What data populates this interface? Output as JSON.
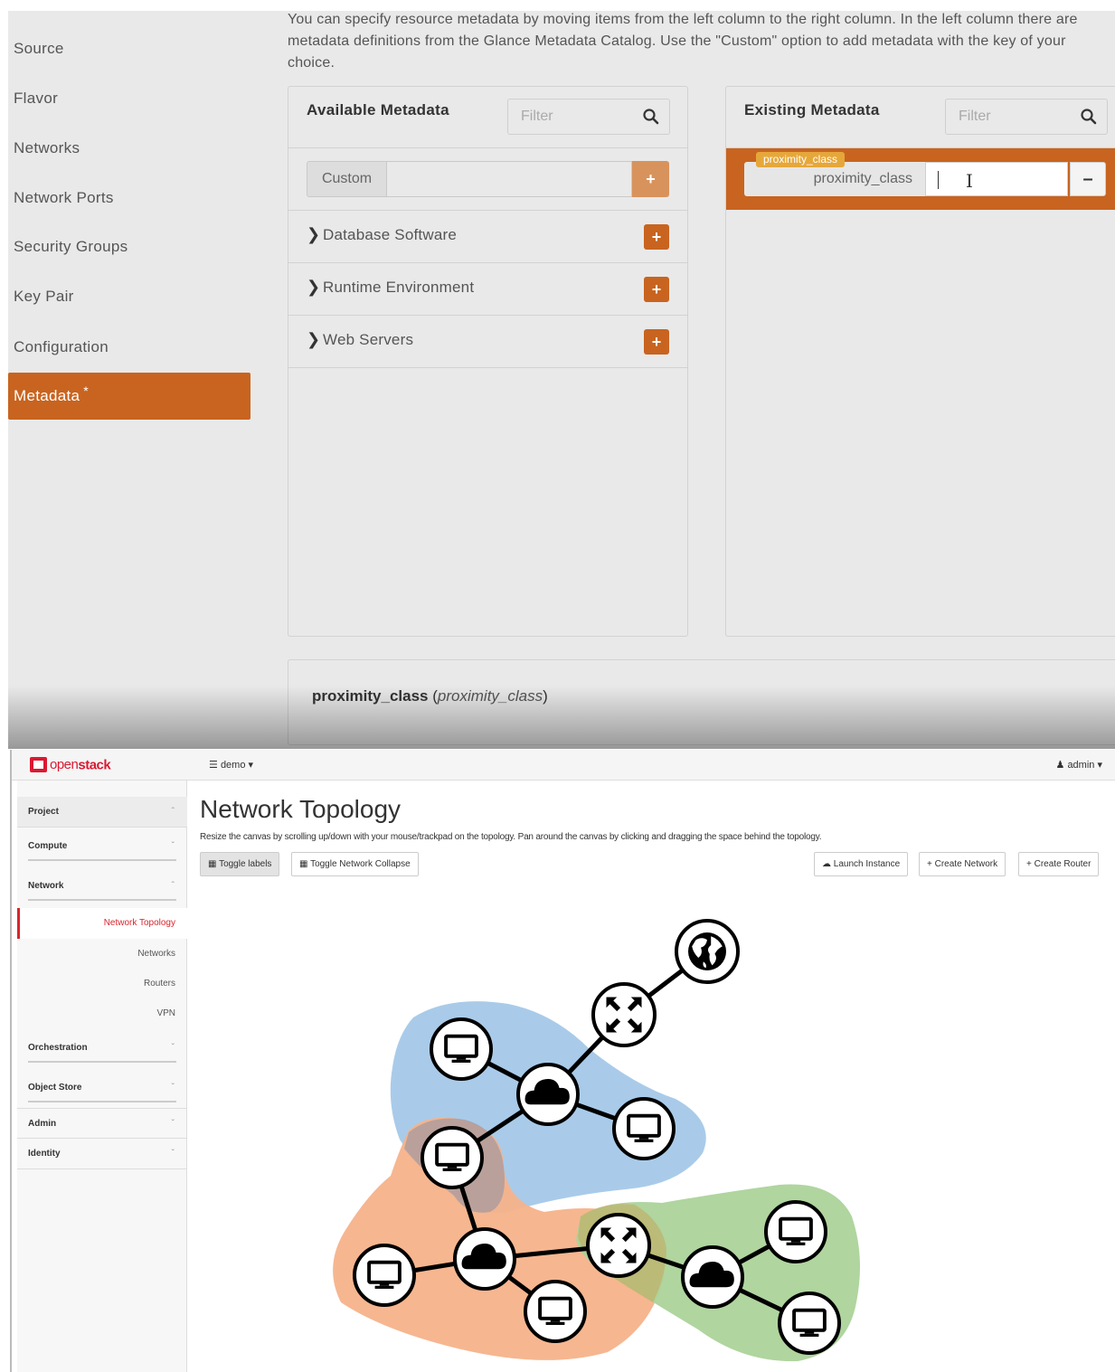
{
  "wizard": {
    "nav": [
      "Source",
      "Flavor",
      "Networks",
      "Network Ports",
      "Security Groups",
      "Key Pair",
      "Configuration",
      "Metadata"
    ],
    "active": "Metadata",
    "active_marker": "*",
    "intro": "You can specify resource metadata by moving items from the left column to the right column. In the left column there are metadata definitions from the Glance Metadata Catalog. Use the \"Custom\" option to add metadata with the key of your choice.",
    "available": {
      "title": "Available Metadata",
      "filter_placeholder": "Filter",
      "custom_label": "Custom",
      "categories": [
        "Database Software",
        "Runtime Environment",
        "Web Servers"
      ]
    },
    "existing": {
      "title": "Existing Metadata",
      "filter_placeholder": "Filter",
      "item_tag": "proximity_class",
      "item_key": "proximity_class",
      "item_value": ""
    },
    "description": {
      "name": "proximity_class",
      "key": "proximity_class"
    }
  },
  "dashboard": {
    "brand_a": "open",
    "brand_b": "stack",
    "project": "demo",
    "user": "admin",
    "sidebar": {
      "project": "Project",
      "compute": "Compute",
      "network": "Network",
      "links": [
        "Network Topology",
        "Networks",
        "Routers",
        "VPN"
      ],
      "orchestration": "Orchestration",
      "object_store": "Object Store",
      "admin": "Admin",
      "identity": "Identity"
    },
    "title": "Network Topology",
    "description": "Resize the canvas by scrolling up/down with your mouse/trackpad on the topology. Pan around the canvas by clicking and dragging the space behind the topology.",
    "buttons": {
      "toggle_labels": "Toggle labels",
      "toggle_collapse": "Toggle Network Collapse",
      "launch": "Launch Instance",
      "create_network": "Create Network",
      "create_router": "Create Router"
    },
    "colors": {
      "network_blue": "#a9cbe9",
      "network_orange": "#f6b28a",
      "network_green": "#acd39a",
      "accent": "#c8641f",
      "brand_red": "#da1a32"
    }
  }
}
